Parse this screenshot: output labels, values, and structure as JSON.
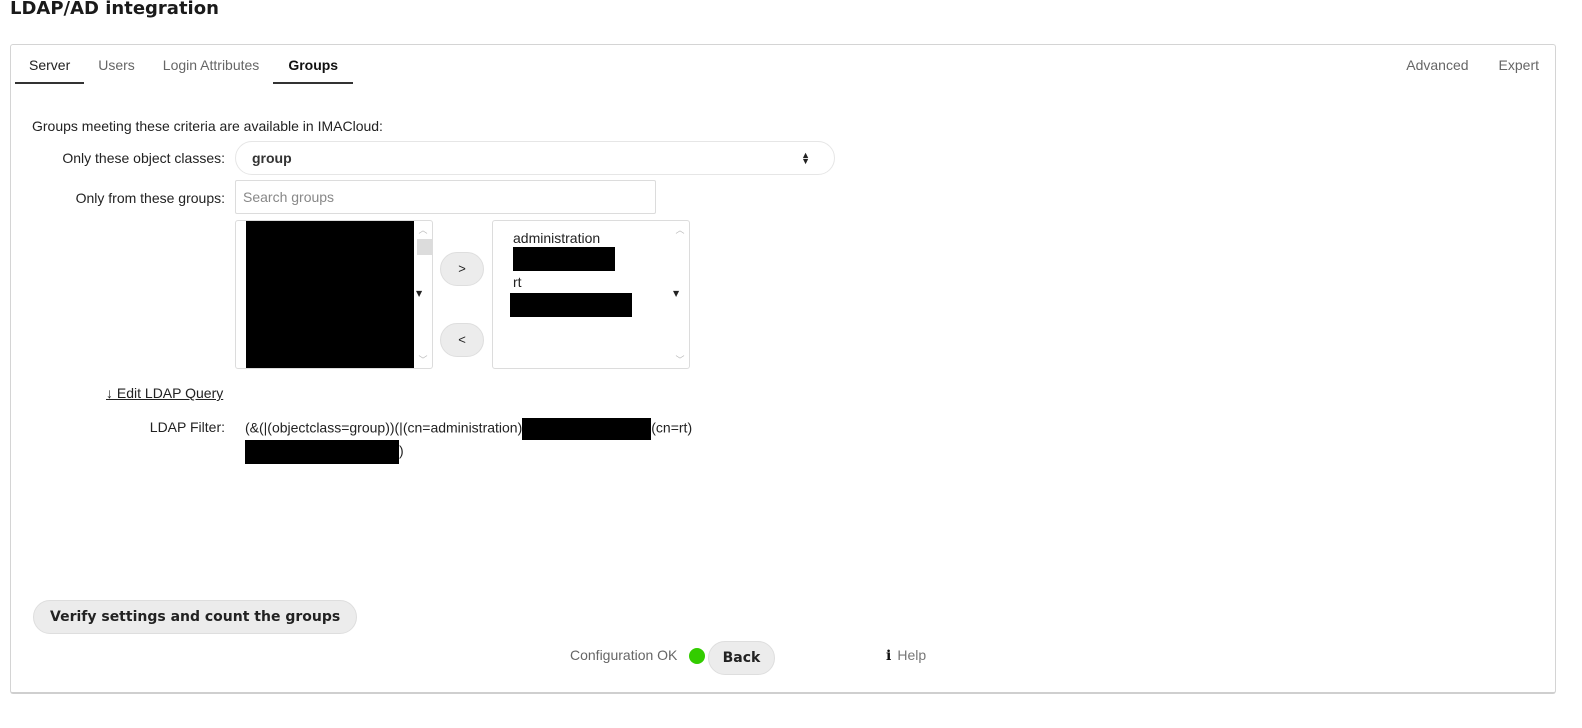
{
  "page": {
    "title": "LDAP/AD integration"
  },
  "tabs": {
    "left": [
      {
        "label": "Server",
        "underlined": true,
        "active": false
      },
      {
        "label": "Users",
        "underlined": false,
        "active": false
      },
      {
        "label": "Login Attributes",
        "underlined": false,
        "active": false
      },
      {
        "label": "Groups",
        "underlined": true,
        "active": true
      }
    ],
    "right": [
      {
        "label": "Advanced"
      },
      {
        "label": "Expert"
      }
    ]
  },
  "form": {
    "intro": "Groups meeting these criteria are available in IMACloud:",
    "object_classes_label": "Only these object classes:",
    "object_classes_value": "group",
    "groups_label": "Only from these groups:",
    "search_placeholder": "Search groups",
    "search_value": "",
    "available_groups": [
      "[redacted]"
    ],
    "selected_groups": [
      "administration",
      "[redacted]",
      "rt",
      "[redacted]"
    ],
    "add_button": ">",
    "remove_button": "<",
    "edit_query_link": "↓ Edit LDAP Query",
    "filter_label": "LDAP Filter:",
    "filter_part1": "(&(|(objectclass=group))(|(cn=administration)",
    "filter_part2": "(cn=rt)",
    "filter_part3": ")"
  },
  "footer": {
    "verify_button": "Verify settings and count the groups",
    "status_text": "Configuration OK",
    "status_color": "#33cc00",
    "back_button": "Back",
    "help_icon": "i",
    "help_label": "Help"
  }
}
